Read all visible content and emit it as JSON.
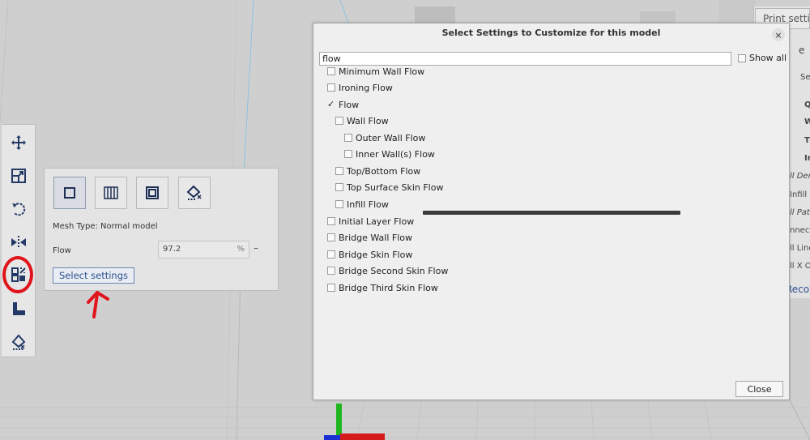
{
  "dialog": {
    "title": "Select Settings to Customize for this model",
    "close_glyph": "×",
    "search_value": "flow",
    "show_all_label": "Show all",
    "show_all_checked": false,
    "close_button_label": "Close",
    "settings": [
      {
        "label": "Minimum Wall Flow",
        "checked": false,
        "level": 0
      },
      {
        "label": "Ironing Flow",
        "checked": false,
        "level": 0
      },
      {
        "label": "Flow",
        "checked": true,
        "level": 0
      },
      {
        "label": "Wall Flow",
        "checked": false,
        "level": 1
      },
      {
        "label": "Outer Wall Flow",
        "checked": false,
        "level": 2
      },
      {
        "label": "Inner Wall(s) Flow",
        "checked": false,
        "level": 2
      },
      {
        "label": "Top/Bottom Flow",
        "checked": false,
        "level": 1
      },
      {
        "label": "Top Surface Skin Flow",
        "checked": false,
        "level": 1
      },
      {
        "label": "Infill Flow",
        "checked": false,
        "level": 1
      },
      {
        "label": "Initial Layer Flow",
        "checked": false,
        "level": 0
      },
      {
        "label": "Bridge Wall Flow",
        "checked": false,
        "level": 0
      },
      {
        "label": "Bridge Skin Flow",
        "checked": false,
        "level": 0
      },
      {
        "label": "Bridge Second Skin Flow",
        "checked": false,
        "level": 0
      },
      {
        "label": "Bridge Third Skin Flow",
        "checked": false,
        "level": 0
      }
    ]
  },
  "per_model_panel": {
    "mesh_type_text": "Mesh Type: Normal model",
    "flow_label": "Flow",
    "flow_value": "97.2",
    "flow_unit": "%",
    "reset_glyph": "–",
    "select_settings_label": "Select settings"
  },
  "toolbar": {
    "tools": [
      "move-icon",
      "scale-icon",
      "rotate-icon",
      "mirror-icon",
      "per-model-settings-icon",
      "support-blocker-icon",
      "paint-support-icon"
    ],
    "selected": "per-model-settings-icon"
  },
  "right_panel": {
    "tab_label": "Print settin",
    "snippets": [
      "e",
      "Se",
      "Q",
      "W",
      "T",
      "Ir",
      "ll Dens",
      "Infill L",
      "ll Patt",
      "nnect",
      "ll Line",
      "ll X Of",
      "Reco"
    ]
  },
  "colors": {
    "annotation_red": "#e0141b",
    "accent_blue": "#2c4f8f",
    "viewport_bg": "#cfcfcf",
    "dialog_bg": "#efefef"
  }
}
